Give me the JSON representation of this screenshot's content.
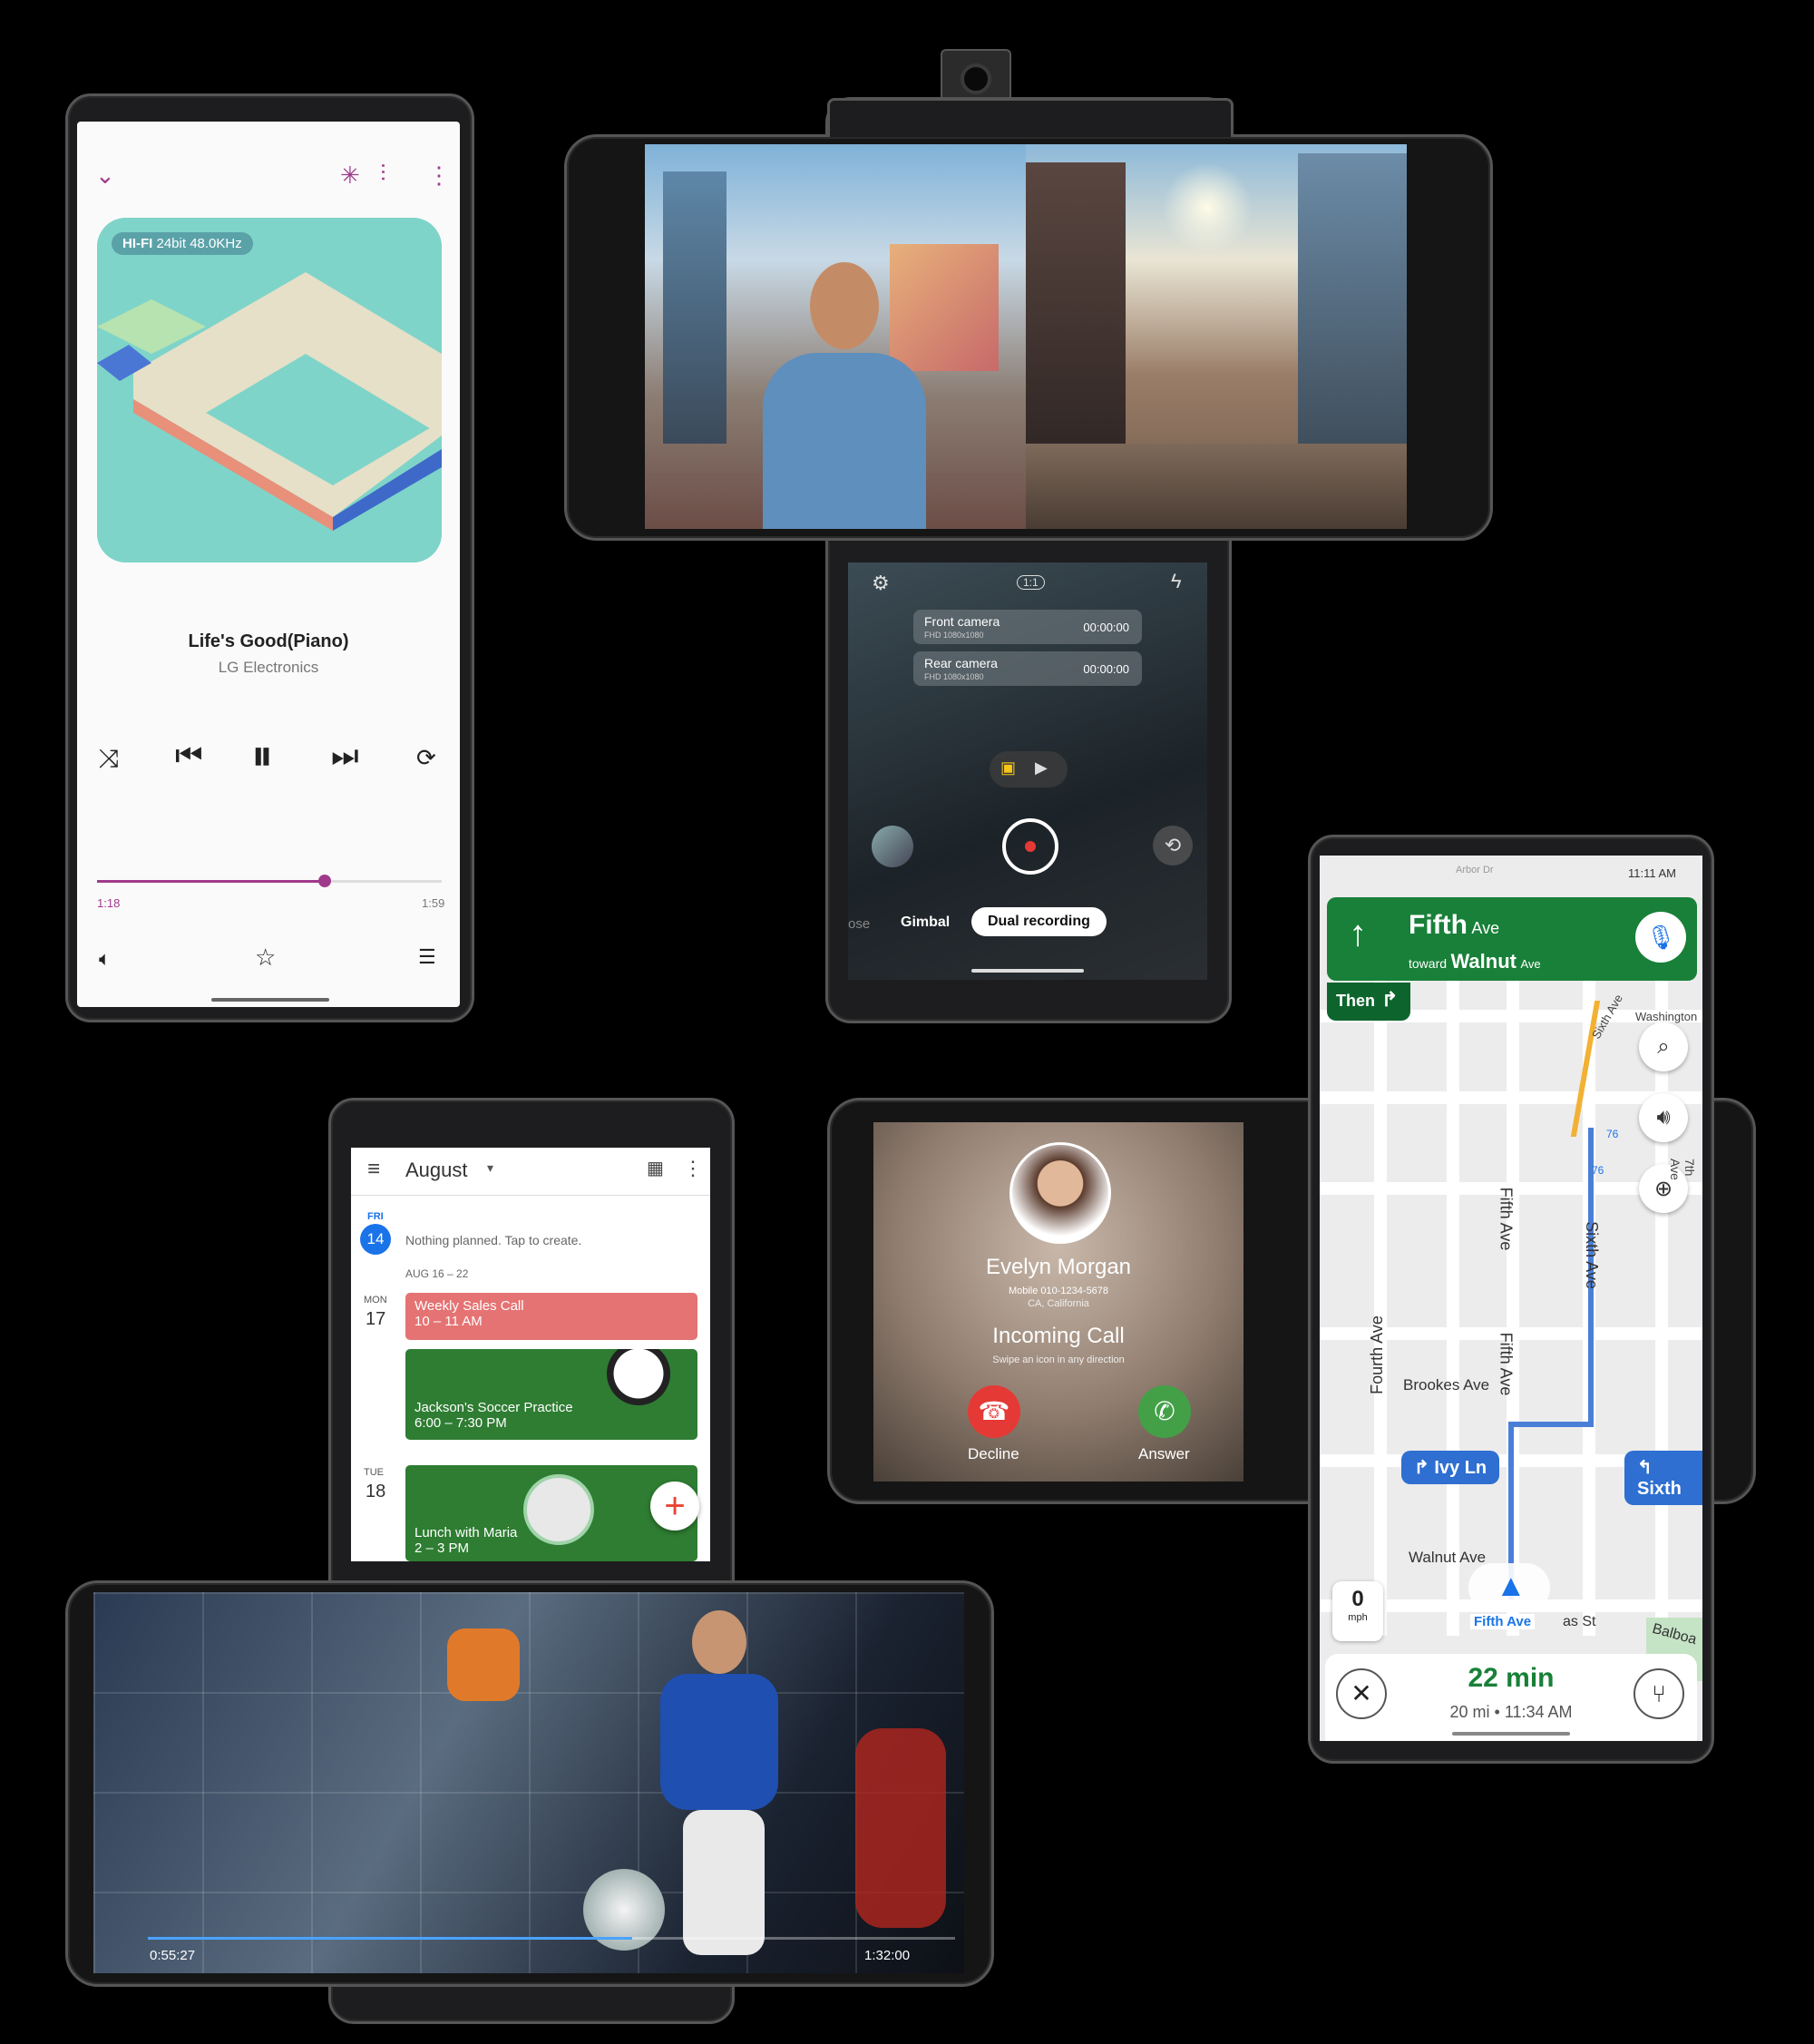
{
  "music": {
    "hifi_badge": "HI-FI",
    "quality": "24bit 48.0KHz",
    "title": "Life's Good(Piano)",
    "artist": "LG Electronics",
    "elapsed": "1:18",
    "duration": "1:59",
    "progress_fraction": 0.66,
    "accent": "#a03a8c"
  },
  "camera": {
    "ratio_label": "1:1",
    "rows": [
      {
        "label": "Front camera",
        "sub": "FHD 1080x1080",
        "time": "00:00:00"
      },
      {
        "label": "Rear camera",
        "sub": "FHD 1080x1080",
        "time": "00:00:00"
      }
    ],
    "modes": [
      "ose",
      "Gimbal",
      "Dual recording"
    ],
    "active_mode": "Dual recording"
  },
  "calendar": {
    "month": "August",
    "today_dow": "FRI",
    "today_num": "14",
    "today_text": "Nothing planned. Tap to create.",
    "week_range": "AUG 16 – 22",
    "days": [
      {
        "dow": "MON",
        "num": "17"
      },
      {
        "dow": "TUE",
        "num": "18"
      }
    ],
    "events": [
      {
        "title": "Weekly Sales Call",
        "time": "10 – 11 AM",
        "color": "#e57373"
      },
      {
        "title": "Jackson's Soccer Practice",
        "time": "6:00 – 7:30 PM",
        "color": "#2e7d32"
      },
      {
        "title": "Lunch with Maria",
        "time": "2 – 3 PM",
        "color": "#2e7d32"
      }
    ]
  },
  "call": {
    "name": "Evelyn Morgan",
    "number": "Mobile 010-1234-5678",
    "location": "CA, California",
    "status": "Incoming Call",
    "hint": "Swipe an icon in any direction",
    "decline": "Decline",
    "answer": "Answer"
  },
  "maps": {
    "time": "11:11 AM",
    "street": "Fifth",
    "street_suffix": "Ave",
    "toward": "toward",
    "toward_street": "Walnut",
    "toward_suffix": "Ave",
    "then": "Then",
    "labels": {
      "arbor": "Arbor Dr",
      "washington": "Washington",
      "sixth_diag": "Sixth Ave",
      "fifth_v1": "Fifth Ave",
      "fifth_v2": "Fifth Ave",
      "sixth_v": "Sixth Ave",
      "fourth": "Fourth Ave",
      "seventh": "7th Ave",
      "brookes": "Brookes Ave",
      "walnut": "Walnut Ave",
      "fifth_pin": "Fifth Ave",
      "as_st": "as St",
      "balboa": "Balboa",
      "num76a": "76",
      "num76b": "76"
    },
    "pill_ivy": "Ivy Ln",
    "pill_sixth": "Sixth",
    "speed": "0",
    "speed_unit": "mph",
    "eta": "22 min",
    "distance": "20 mi",
    "arrival": "11:34 AM",
    "green": "#188038"
  },
  "video": {
    "elapsed": "0:55:27",
    "duration": "1:32:00",
    "progress_fraction": 0.6
  }
}
